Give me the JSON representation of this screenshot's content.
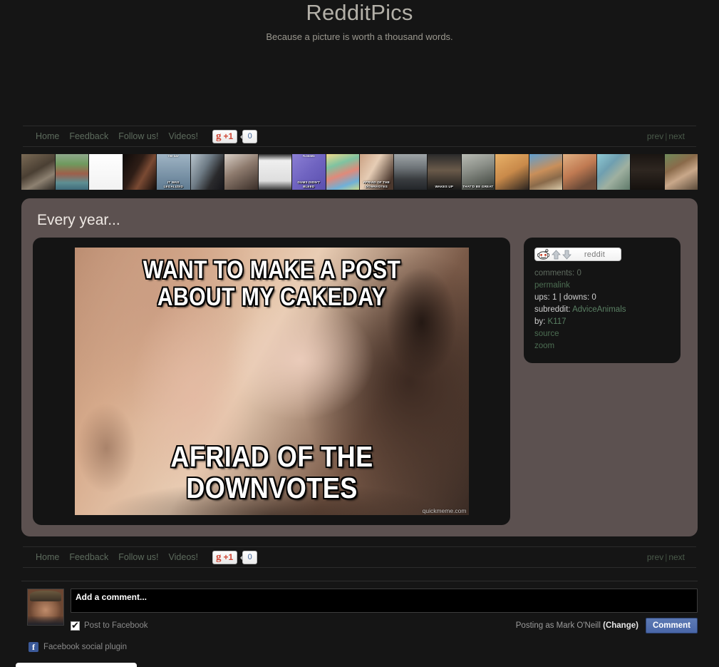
{
  "site": {
    "title": "RedditPics",
    "tagline": "Because a picture is worth a thousand words."
  },
  "nav": {
    "links": [
      {
        "label": "Home",
        "name": "home"
      },
      {
        "label": "Feedback",
        "name": "feedback"
      },
      {
        "label": "Follow us!",
        "name": "follow-us"
      },
      {
        "label": "Videos!",
        "name": "videos"
      }
    ],
    "gplus": {
      "logo": "g",
      "plus_label": "+1",
      "count": "0"
    },
    "prev": "prev",
    "separator": "|",
    "next": "next"
  },
  "thumbnails": [
    {
      "name": "thumb-1",
      "top": "",
      "label": "",
      "css": "linear-gradient(150deg,#7a6a55,#4a3f33 45%,#8d8171 70%,#2e2a25)"
    },
    {
      "name": "thumb-2",
      "top": "",
      "label": "",
      "css": "linear-gradient(180deg,#8fa98c 0%,#6f9a5e 28%,#9e5f4a 55%,#5d8f93 80%,#3f6b7a 100%)"
    },
    {
      "name": "thumb-3",
      "top": "",
      "label": "",
      "css": "linear-gradient(0deg,#f2f2f2,#ffffff)"
    },
    {
      "name": "thumb-4",
      "top": "",
      "label": "",
      "css": "linear-gradient(120deg,#0d0a09,#2e1d16 40%,#7a4a33 62%,#120c0a)"
    },
    {
      "name": "thumb-5",
      "top": "THE DAY",
      "label": "IT WAS LEGALIZED",
      "css": "linear-gradient(180deg,#9fb4c4,#7f97ab 50%,#5f7b91)"
    },
    {
      "name": "thumb-6",
      "top": "",
      "label": "",
      "css": "linear-gradient(120deg,#b9c6cf,#6e7b85 40%,#2a2a2c 70%,#15151a)"
    },
    {
      "name": "thumb-7",
      "top": "",
      "label": "",
      "css": "linear-gradient(150deg,#d9cfc6,#8d7a6d 45%,#3a2e28)"
    },
    {
      "name": "thumb-8",
      "top": "",
      "label": "",
      "css": "linear-gradient(180deg,#2b2b2b,#efefef 18%,#dedede 75%,#3a3a3a)"
    },
    {
      "name": "thumb-9",
      "top": "FLOSSED",
      "label": "GUMS DIDN'T BLEED",
      "css": "linear-gradient(135deg,#8b7fd4,#6f63c0 50%,#5a4fae)"
    },
    {
      "name": "thumb-10",
      "top": "",
      "label": "",
      "css": "linear-gradient(160deg,#f0d98a,#7fc3a1 30%,#e08a7a 55%,#6fb0d8 80%,#c7d98a)"
    },
    {
      "name": "thumb-11",
      "top": "",
      "label": "AFRIAD OF THE DOWNVOTES",
      "css": "linear-gradient(120deg,#caa183,#e6cdb5 40%,#4a372d 85%)"
    },
    {
      "name": "thumb-12",
      "top": "",
      "label": "",
      "css": "linear-gradient(180deg,#9fa5a8,#6c7276 40%,#3a3d40 70%,#23262a)"
    },
    {
      "name": "thumb-13",
      "top": "",
      "label": "WAKES UP",
      "css": "linear-gradient(180deg,#2a2a2a,#6a5a4a 45%,#1a1a1a)"
    },
    {
      "name": "thumb-14",
      "top": "",
      "label": "THAT'D BE GREAT",
      "css": "linear-gradient(160deg,#b9bcb4,#8b8f88 40%,#5a5f58 75%,#30332f)"
    },
    {
      "name": "thumb-15",
      "top": "",
      "label": "",
      "css": "linear-gradient(150deg,#e8b168,#c98a4a 50%,#2a2420)"
    },
    {
      "name": "thumb-16",
      "top": "",
      "label": "",
      "css": "linear-gradient(160deg,#5f9fd0,#c98f5a 45%,#8a6a4a 70%,#d8c8a8)"
    },
    {
      "name": "thumb-17",
      "top": "",
      "label": "",
      "css": "linear-gradient(150deg,#e2b183,#c07a52 45%,#6a4a38 80%)"
    },
    {
      "name": "thumb-18",
      "top": "",
      "label": "",
      "css": "linear-gradient(135deg,#8ec9d4,#6f9fb0 35%,#9fb0a0 60%,#5f7a6a)"
    },
    {
      "name": "thumb-19",
      "top": "",
      "label": "",
      "css": "linear-gradient(180deg,#1a1512,#2e2620 45%,#15110e)"
    },
    {
      "name": "thumb-20",
      "top": "",
      "label": "",
      "css": "linear-gradient(150deg,#6f8a5a,#8a6a4a 35%,#c9a88a 60%,#5a4a3a)"
    }
  ],
  "post": {
    "title": "Every year...",
    "meme_top_text": "WANT TO MAKE A POST ABOUT MY CAKEDAY",
    "meme_bottom_text": "AFRIAD OF THE DOWNVOTES",
    "watermark": "quickmeme.com"
  },
  "sidebar": {
    "reddit_button_label": "reddit",
    "comments_label": "comments:",
    "comments_count": "0",
    "permalink": "permalink",
    "ups_label": "ups:",
    "ups_count": "1",
    "ups_sep": "|",
    "downs_label": "downs:",
    "downs_count": "0",
    "subreddit_label": "subreddit:",
    "subreddit_value": "AdviceAnimals",
    "by_label": "by:",
    "by_value": "K117",
    "source": "source",
    "zoom": "zoom"
  },
  "comments": {
    "input_value": "Add a comment...",
    "input_placeholder": "Add a comment...",
    "post_to_facebook": "Post to Facebook",
    "posting_as": "Posting as Mark O'Neill",
    "change_label": "(Change)",
    "comment_button": "Comment",
    "plugin_label": "Facebook social plugin",
    "fb_icon_letter": "f"
  },
  "colors": {
    "page_bg": "#151515",
    "card_bg": "#5c5150",
    "panel_bg": "#141414",
    "nav_link": "#5d6b5d",
    "title": "#b3b0a8",
    "comment_button": "#4a67a8",
    "facebook": "#3b5998",
    "gplus_red": "#d14836"
  }
}
